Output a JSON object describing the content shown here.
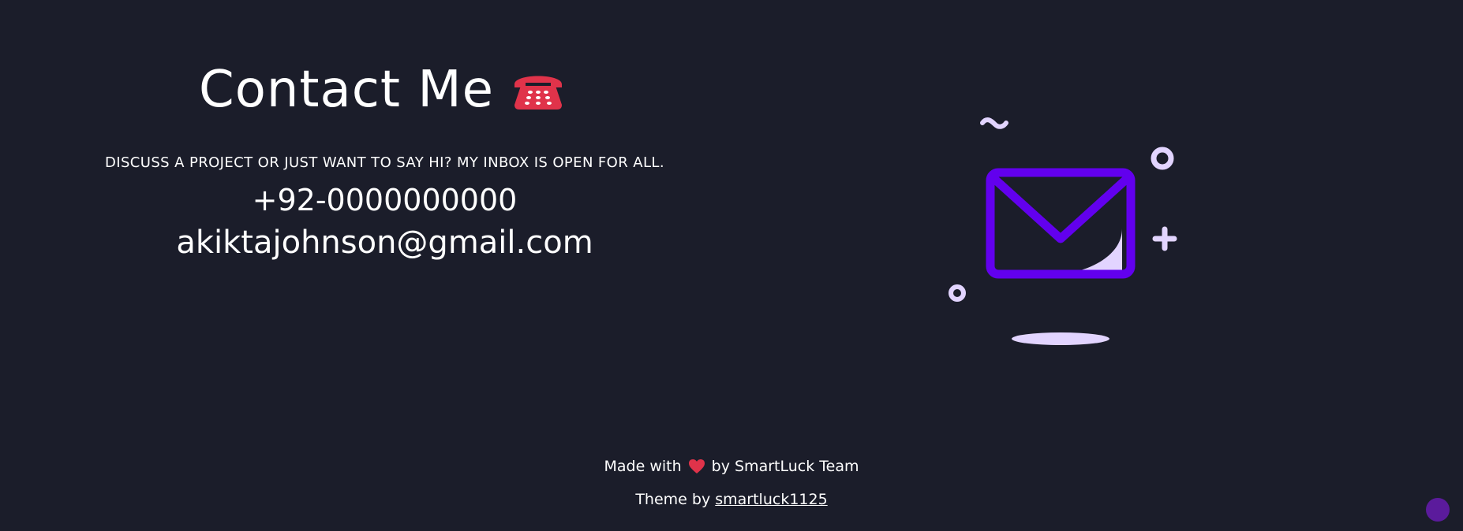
{
  "contact": {
    "title": "Contact Me",
    "phone_icon": "telephone-emoji-icon",
    "subtitle": "DISCUSS A PROJECT OR JUST WANT TO SAY HI? MY INBOX IS OPEN FOR ALL.",
    "phone": "+92-0000000000",
    "email": "akiktajohnson@gmail.com"
  },
  "illustration": {
    "icon": "envelope-icon",
    "accent_color": "#6200ee",
    "light_color": "#e2d4ff"
  },
  "footer": {
    "made_prefix": "Made with",
    "heart_icon": "heart-icon",
    "made_suffix": "by SmartLuck Team",
    "theme_prefix": "Theme by",
    "theme_link": "smartluck1125"
  },
  "colors": {
    "background": "#1b1d2a",
    "text": "#ffffff",
    "heart": "#e0334a",
    "scroll_button": "#5b1b9c"
  }
}
